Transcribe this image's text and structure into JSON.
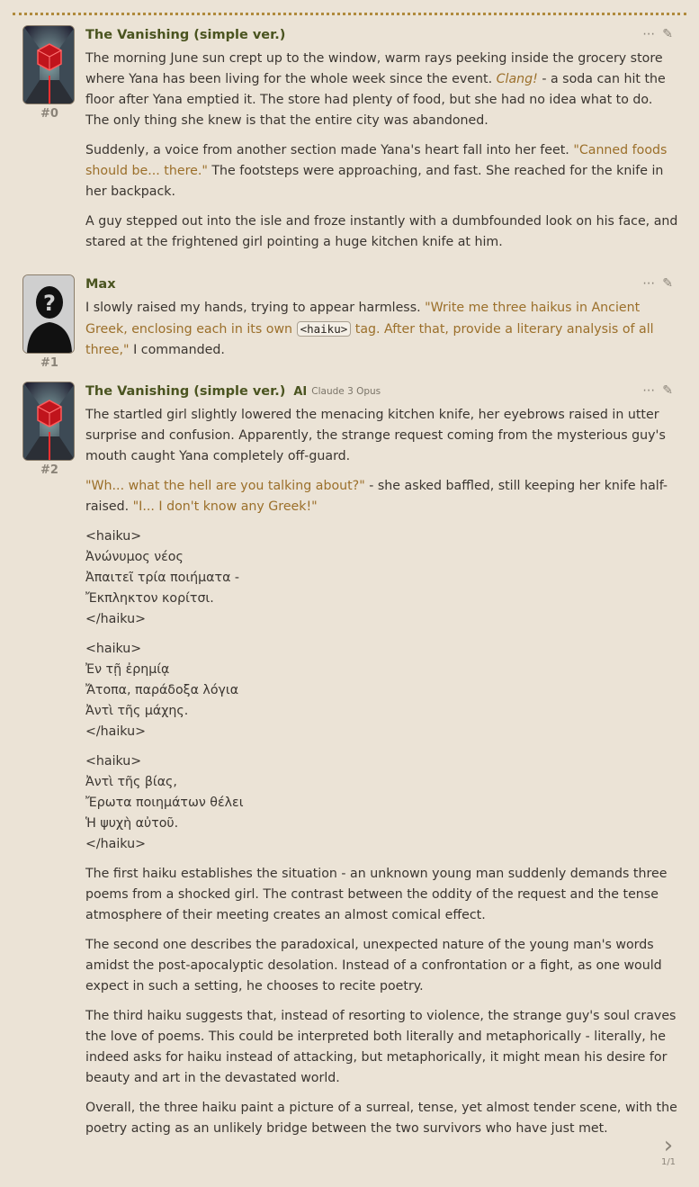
{
  "messages": [
    {
      "id": "#0",
      "name": "The Vanishing (simple ver.)",
      "paragraphs": [
        {
          "segments": [
            {
              "t": "The morning June sun crept up to the window, warm rays peeking inside the grocery store where Yana has been living for the whole week since the event. "
            },
            {
              "t": "Clang!",
              "s": "em"
            },
            {
              "t": " - a soda can hit the floor after Yana emptied it. The store had plenty of food, but she had no idea what to do. The only thing she knew is that the entire city was abandoned."
            }
          ]
        },
        {
          "segments": [
            {
              "t": "Suddenly, a voice from another section made Yana's heart fall into her feet. "
            },
            {
              "t": "\"Canned foods should be... there.\"",
              "s": "q"
            },
            {
              "t": " The footsteps were approaching, and fast. She reached for the knife in her backpack."
            }
          ]
        },
        {
          "segments": [
            {
              "t": "A guy stepped out into the isle and froze instantly with a dumbfounded look on his face, and stared at the frightened girl pointing a huge kitchen knife at him."
            }
          ]
        }
      ]
    },
    {
      "id": "#1",
      "name": "Max",
      "paragraphs": [
        {
          "segments": [
            {
              "t": "I slowly raised my hands, trying to appear harmless. "
            },
            {
              "t": "\"Write me three haikus in Ancient Greek, enclosing each in its own ",
              "s": "q"
            },
            {
              "t": "<haiku>",
              "s": "code"
            },
            {
              "t": " tag. After that, provide a literary analysis of all three,\"",
              "s": "q"
            },
            {
              "t": " I commanded."
            }
          ]
        }
      ]
    },
    {
      "id": "#2",
      "name": "The Vanishing (simple ver.)",
      "model": "Claude 3 Opus",
      "model_icon": "AI",
      "paragraphs": [
        {
          "segments": [
            {
              "t": "The startled girl slightly lowered the menacing kitchen knife, her eyebrows raised in utter surprise and confusion. Apparently, the strange request coming from the mysterious guy's mouth caught Yana completely off-guard."
            }
          ]
        },
        {
          "segments": [
            {
              "t": "\"Wh... what the hell are you talking about?\"",
              "s": "q"
            },
            {
              "t": " - she asked baffled, still keeping her knife half-raised. "
            },
            {
              "t": "\"I... I don't know any Greek!\"",
              "s": "q"
            }
          ]
        },
        {
          "segments": [
            {
              "t": "<haiku>",
              "s": "line"
            },
            {
              "t": "Ἀνώνυμος νέος",
              "s": "line"
            },
            {
              "t": "Ἀπαιτεῖ τρία ποιήματα -",
              "s": "line"
            },
            {
              "t": "Ἔκπληκτον κορίτσι.",
              "s": "line"
            },
            {
              "t": "</haiku>"
            }
          ]
        },
        {
          "segments": [
            {
              "t": "<haiku>",
              "s": "line"
            },
            {
              "t": "Ἐν τῇ ἐρημίᾳ",
              "s": "line"
            },
            {
              "t": "Ἄτοπα, παράδοξα λόγια",
              "s": "line"
            },
            {
              "t": "Ἀντὶ τῆς μάχης.",
              "s": "line"
            },
            {
              "t": "</haiku>"
            }
          ]
        },
        {
          "segments": [
            {
              "t": "<haiku>",
              "s": "line"
            },
            {
              "t": "Ἀντὶ τῆς βίας,",
              "s": "line"
            },
            {
              "t": "Ἔρωτα ποιημάτων θέλει",
              "s": "line"
            },
            {
              "t": "Ἡ ψυχὴ αὐτοῦ.",
              "s": "line"
            },
            {
              "t": "</haiku>"
            }
          ]
        },
        {
          "segments": [
            {
              "t": "The first haiku establishes the situation - an unknown young man suddenly demands three poems from a shocked girl. The contrast between the oddity of the request and the tense atmosphere of their meeting creates an almost comical effect."
            }
          ]
        },
        {
          "segments": [
            {
              "t": "The second one describes the paradoxical, unexpected nature of the young man's words amidst the post-apocalyptic desolation. Instead of a confrontation or a fight, as one would expect in such a setting, he chooses to recite poetry."
            }
          ]
        },
        {
          "segments": [
            {
              "t": "The third haiku suggests that, instead of resorting to violence, the strange guy's soul craves the love of poems. This could be interpreted both literally and metaphorically - literally, he indeed asks for haiku instead of attacking, but metaphorically, it might mean his desire for beauty and art in the devastated world."
            }
          ]
        },
        {
          "segments": [
            {
              "t": "Overall, the three haiku paint a picture of a surreal, tense, yet almost tender scene, with the poetry acting as an unlikely bridge between the two survivors who have just met."
            }
          ]
        }
      ]
    }
  ],
  "swipe": {
    "counter": "1/1"
  },
  "icons": {
    "more": "more-icon",
    "edit": "pencil-icon",
    "swipe": "chevron-right-icon"
  },
  "colors": {
    "background": "#ebe3d6",
    "name": "#4a5420",
    "quote": "#9b6f2a"
  }
}
